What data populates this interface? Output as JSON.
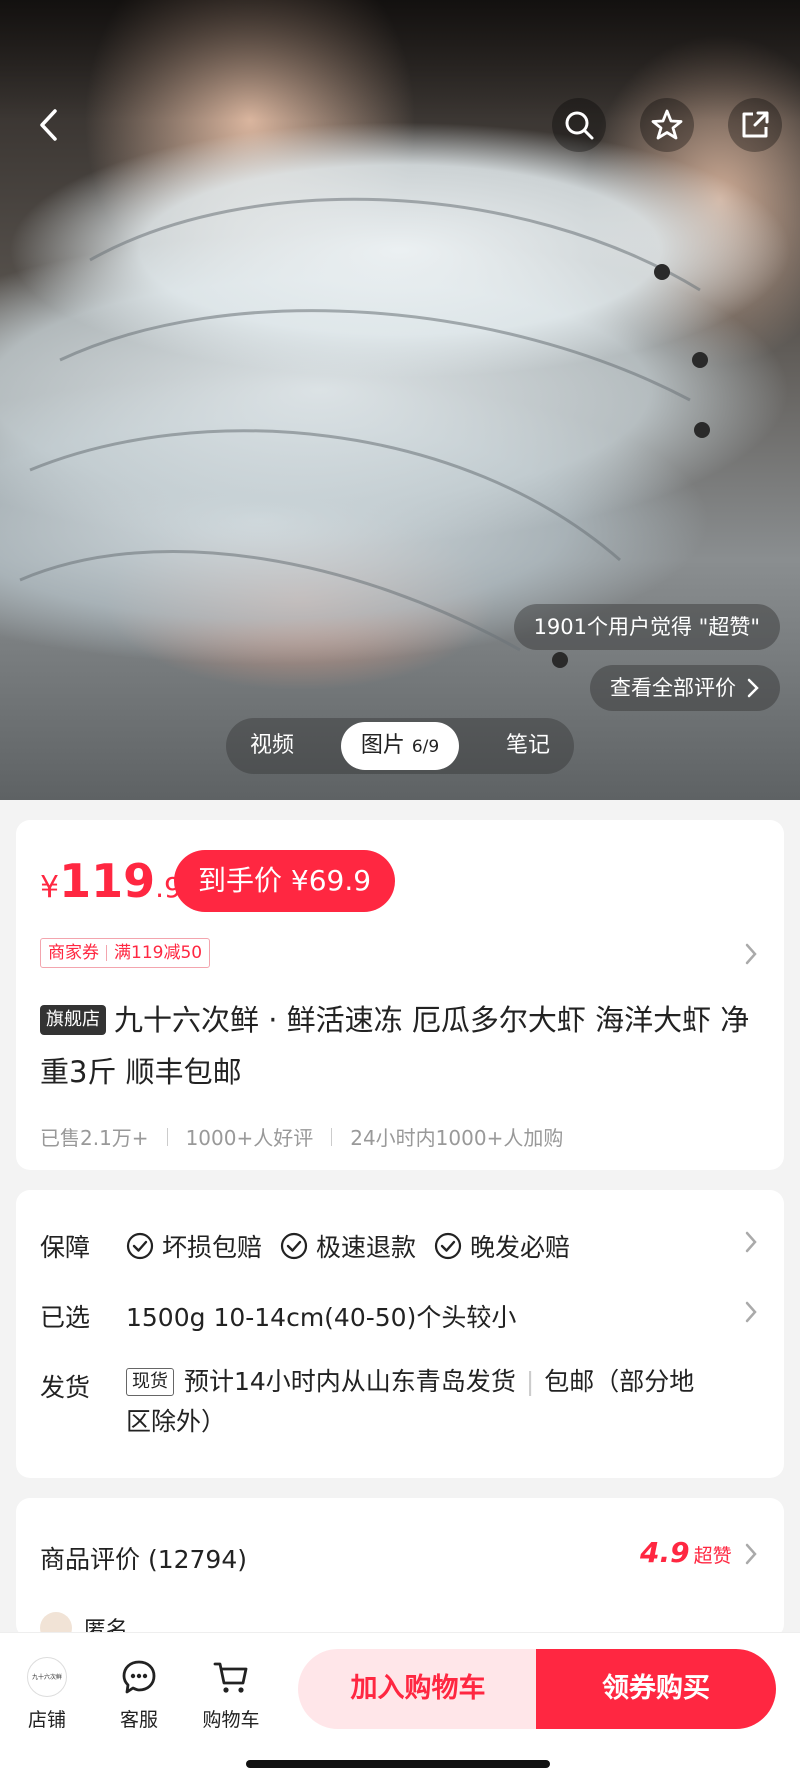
{
  "hero": {
    "tabs": [
      {
        "label": "视频"
      },
      {
        "label": "图片",
        "counter": "6/9",
        "active": true
      },
      {
        "label": "笔记"
      }
    ],
    "praise_text": "1901个用户觉得 \"超赞\"",
    "view_reviews": "查看全部评价"
  },
  "price": {
    "symbol": "¥",
    "integer": "119",
    "decimal": ".9",
    "final_label": "到手价 ¥69.9",
    "coupon_type": "商家券",
    "coupon_rule": "满119减50"
  },
  "product": {
    "flag": "旗舰店",
    "title": "九十六次鲜 · 鲜活速冻 厄瓜多尔大虾 海洋大虾 净重3斤 顺丰包邮",
    "stats": [
      "已售2.1万+",
      "1000+人好评",
      "24小时内1000+人加购"
    ]
  },
  "service": {
    "guarantee_label": "保障",
    "guarantees": [
      "坏损包赔",
      "极速退款",
      "晚发必赔"
    ],
    "selected_label": "已选",
    "selected_value": "1500g 10-14cm(40-50)个头较小",
    "ship_label": "发货",
    "ship_tag": "现货",
    "ship_text": "预计14小时内从山东青岛发货",
    "ship_free": "包邮（部分地区除外）"
  },
  "reviews": {
    "title": "商品评价 (12794)",
    "score": "4.9",
    "score_label": "超赞",
    "first_user": "匿名"
  },
  "bottom": {
    "store_label": "店铺",
    "store_logo_text": "九十六次鲜",
    "service_label": "客服",
    "cart_label": "购物车",
    "add_cart": "加入购物车",
    "buy": "领券购买"
  },
  "colors": {
    "accent": "#ff2741"
  }
}
